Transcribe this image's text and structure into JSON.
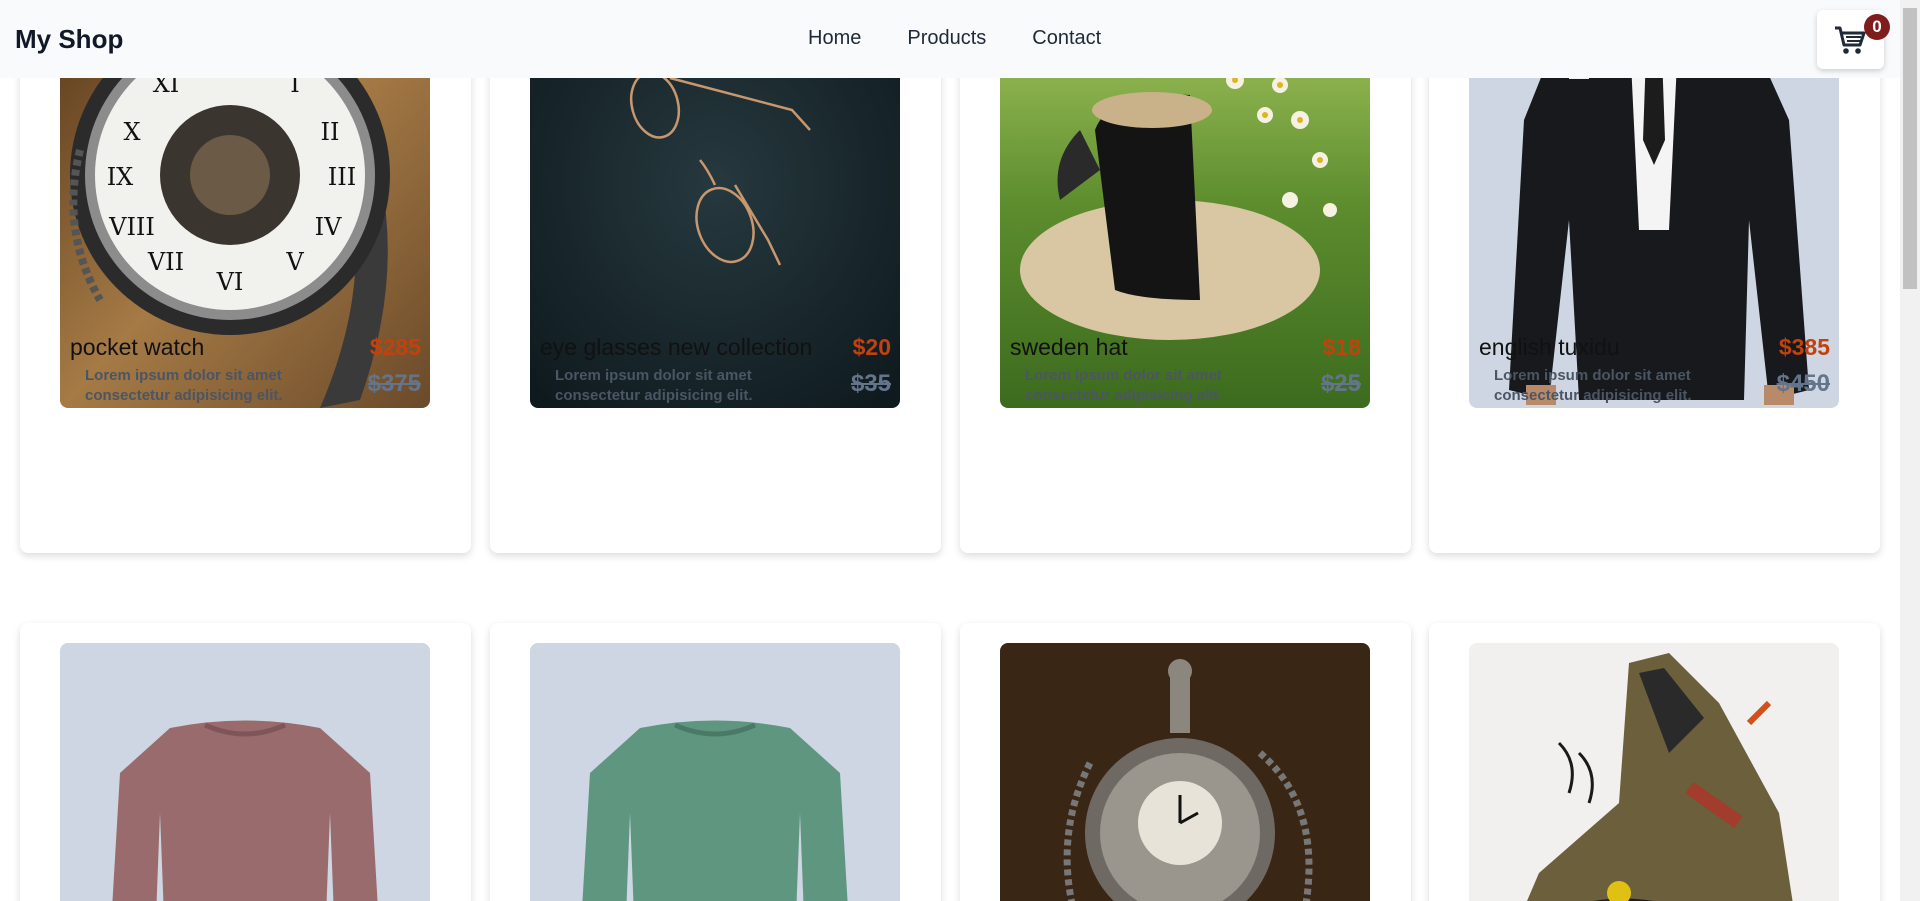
{
  "app": {
    "title": "My Shop"
  },
  "nav": {
    "items": [
      "Home",
      "Products",
      "Contact"
    ]
  },
  "cart": {
    "count": "0",
    "icon": "cart-icon"
  },
  "products": [
    {
      "name": "pocket watch",
      "price": "$285",
      "old_price": "$375",
      "description": "Lorem ipsum dolor sit amet consectetur adipisicing elit."
    },
    {
      "name": "eye glasses new collection",
      "price": "$20",
      "old_price": "$35",
      "description": "Lorem ipsum dolor sit amet consectetur adipisicing elit."
    },
    {
      "name": "sweden hat",
      "price": "$18",
      "old_price": "$25",
      "description": "Lorem ipsum dolor sit amet consectetur adipisicing elit."
    },
    {
      "name": "english tuxidu",
      "price": "$385",
      "old_price": "$450",
      "description": "Lorem ipsum dolor sit amet consectetur adipisicing elit."
    }
  ],
  "colors": {
    "price": "#c2410c",
    "badge": "#7f1d1d",
    "header_bg": "#f8fafc"
  }
}
